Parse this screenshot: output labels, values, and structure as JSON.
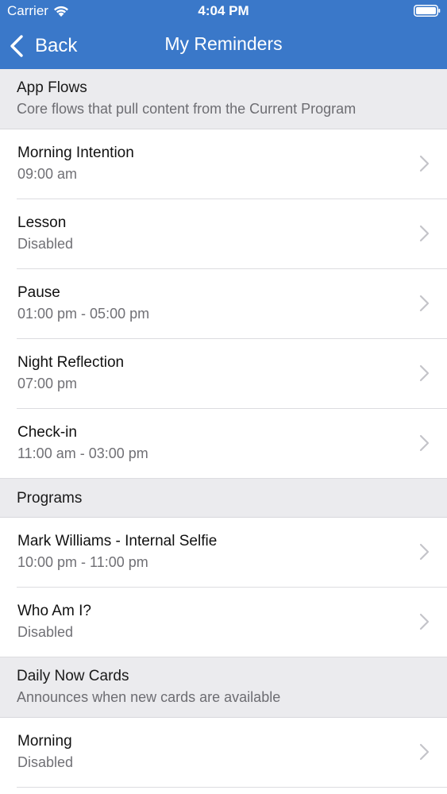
{
  "status_bar": {
    "carrier": "Carrier",
    "time": "4:04 PM"
  },
  "nav": {
    "back_label": "Back",
    "title": "My Reminders"
  },
  "colors": {
    "accent": "#3a78c9",
    "section_bg": "#ebebee"
  },
  "sections": [
    {
      "title": "App Flows",
      "subtitle": "Core flows that pull content from the Current Program",
      "items": [
        {
          "title": "Morning Intention",
          "detail": "09:00 am"
        },
        {
          "title": "Lesson",
          "detail": "Disabled"
        },
        {
          "title": "Pause",
          "detail": "01:00 pm - 05:00 pm"
        },
        {
          "title": "Night Reflection",
          "detail": "07:00 pm"
        },
        {
          "title": "Check-in",
          "detail": "11:00 am - 03:00 pm"
        }
      ]
    },
    {
      "title": "Programs",
      "items": [
        {
          "title": "Mark Williams - Internal Selfie",
          "detail": "10:00 pm - 11:00 pm"
        },
        {
          "title": "Who Am I?",
          "detail": "Disabled"
        }
      ]
    },
    {
      "title": "Daily Now Cards",
      "subtitle": "Announces when new cards are available",
      "items": [
        {
          "title": "Morning",
          "detail": "Disabled"
        }
      ]
    }
  ]
}
